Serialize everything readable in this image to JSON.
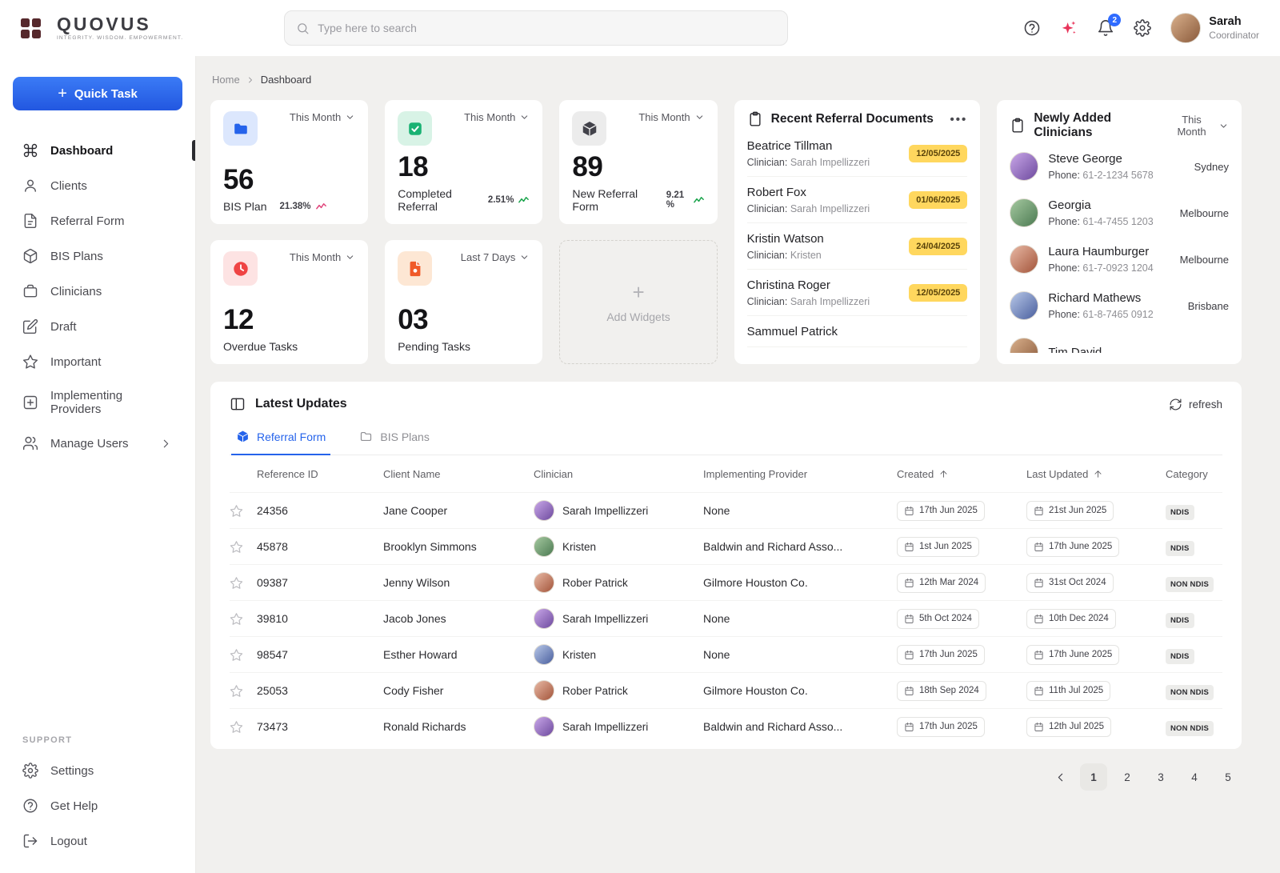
{
  "colors": {
    "accent": "#2563eb",
    "badge_yellow": "#ffd75e",
    "positive": "#18a34a",
    "negative": "#e0457b",
    "sidebar_active": "#151518"
  },
  "topbar": {
    "logo_text": "QUOVUS",
    "logo_tagline": "INTEGRITY. WISDOM. EMPOWERMENT.",
    "search_placeholder": "Type here to search",
    "notification_count": "2",
    "user_name": "Sarah",
    "user_role": "Coordinator"
  },
  "sidebar": {
    "quick_task_label": "Quick Task",
    "items": [
      {
        "label": "Dashboard"
      },
      {
        "label": "Clients"
      },
      {
        "label": "Referral Form"
      },
      {
        "label": "BIS Plans"
      },
      {
        "label": "Clinicians"
      },
      {
        "label": "Draft"
      },
      {
        "label": "Important"
      },
      {
        "label": "Implementing Providers"
      },
      {
        "label": "Manage Users"
      }
    ],
    "support_label": "SUPPORT",
    "support_items": [
      {
        "label": "Settings"
      },
      {
        "label": "Get Help"
      },
      {
        "label": "Logout"
      }
    ]
  },
  "breadcrumb": {
    "home": "Home",
    "current": "Dashboard"
  },
  "stats": {
    "bis_plan": {
      "period": "This Month",
      "value": "56",
      "label": "BIS Plan",
      "change": "21.38%",
      "trend": "down"
    },
    "completed_referral": {
      "period": "This Month",
      "value": "18",
      "label": "Completed Referral",
      "change": "2.51%",
      "trend": "up"
    },
    "new_referral": {
      "period": "This Month",
      "value": "89",
      "label": "New Referral Form",
      "change": "9.21 %",
      "trend": "up"
    },
    "overdue_tasks": {
      "period": "This Month",
      "value": "12",
      "label": "Overdue Tasks"
    },
    "pending_tasks": {
      "period": "Last 7 Days",
      "value": "03",
      "label": "Pending Tasks"
    }
  },
  "widgets": {
    "add_label": "Add Widgets"
  },
  "recent_referrals": {
    "title": "Recent Referral Documents",
    "clinician_prefix": "Clinician:",
    "items": [
      {
        "name": "Beatrice Tillman",
        "clinician": "Sarah Impellizzeri",
        "date": "12/05/2025"
      },
      {
        "name": "Robert Fox",
        "clinician": "Sarah Impellizzeri",
        "date": "01/06/2025"
      },
      {
        "name": "Kristin Watson",
        "clinician": "Kristen",
        "date": "24/04/2025"
      },
      {
        "name": "Christina Roger",
        "clinician": "Sarah Impellizzeri",
        "date": "12/05/2025"
      },
      {
        "name": "Sammuel Patrick",
        "clinician": "",
        "date": ""
      }
    ]
  },
  "new_clinicians": {
    "title": "Newly Added Clinicians",
    "period": "This Month",
    "phone_prefix": "Phone:",
    "items": [
      {
        "name": "Steve George",
        "phone": "61-2-1234 5678",
        "city": "Sydney"
      },
      {
        "name": "Georgia",
        "phone": "61-4-7455 1203",
        "city": "Melbourne"
      },
      {
        "name": "Laura Haumburger",
        "phone": "61-7-0923 1204",
        "city": "Melbourne"
      },
      {
        "name": "Richard Mathews",
        "phone": "61-8-7465 0912",
        "city": "Brisbane"
      },
      {
        "name": "Tim David",
        "phone": "",
        "city": ""
      }
    ]
  },
  "latest": {
    "title": "Latest Updates",
    "refresh_label": "refresh",
    "tabs": [
      {
        "label": "Referral Form"
      },
      {
        "label": "BIS Plans"
      }
    ],
    "headers": {
      "reference_id": "Reference ID",
      "client_name": "Client Name",
      "clinician": "Clinician",
      "provider": "Implementing Provider",
      "created": "Created",
      "updated": "Last Updated",
      "category": "Category"
    },
    "rows": [
      {
        "reference_id": "24356",
        "client": "Jane Cooper",
        "clinician": "Sarah Impellizzeri",
        "provider": "None",
        "created": "17th Jun 2025",
        "updated": "21st Jun 2025",
        "category": "NDIS"
      },
      {
        "reference_id": "45878",
        "client": "Brooklyn Simmons",
        "clinician": "Kristen",
        "provider": "Baldwin and Richard Asso...",
        "created": "1st Jun 2025",
        "updated": "17th June 2025",
        "category": "NDIS"
      },
      {
        "reference_id": "09387",
        "client": "Jenny Wilson",
        "clinician": "Rober Patrick",
        "provider": "Gilmore Houston Co.",
        "created": "12th Mar 2024",
        "updated": "31st Oct 2024",
        "category": "NON NDIS"
      },
      {
        "reference_id": "39810",
        "client": "Jacob Jones",
        "clinician": "Sarah Impellizzeri",
        "provider": "None",
        "created": "5th Oct 2024",
        "updated": "10th Dec 2024",
        "category": "NDIS"
      },
      {
        "reference_id": "98547",
        "client": "Esther Howard",
        "clinician": "Kristen",
        "provider": "None",
        "created": "17th Jun 2025",
        "updated": "17th June 2025",
        "category": "NDIS"
      },
      {
        "reference_id": "25053",
        "client": "Cody Fisher",
        "clinician": "Rober Patrick",
        "provider": "Gilmore Houston Co.",
        "created": "18th Sep 2024",
        "updated": "11th Jul 2025",
        "category": "NON NDIS"
      },
      {
        "reference_id": "73473",
        "client": "Ronald Richards",
        "clinician": "Sarah Impellizzeri",
        "provider": "Baldwin and Richard Asso...",
        "created": "17th Jun 2025",
        "updated": "12th Jul 2025",
        "category": "NON NDIS"
      }
    ],
    "pagination": [
      "1",
      "2",
      "3",
      "4",
      "5"
    ]
  }
}
